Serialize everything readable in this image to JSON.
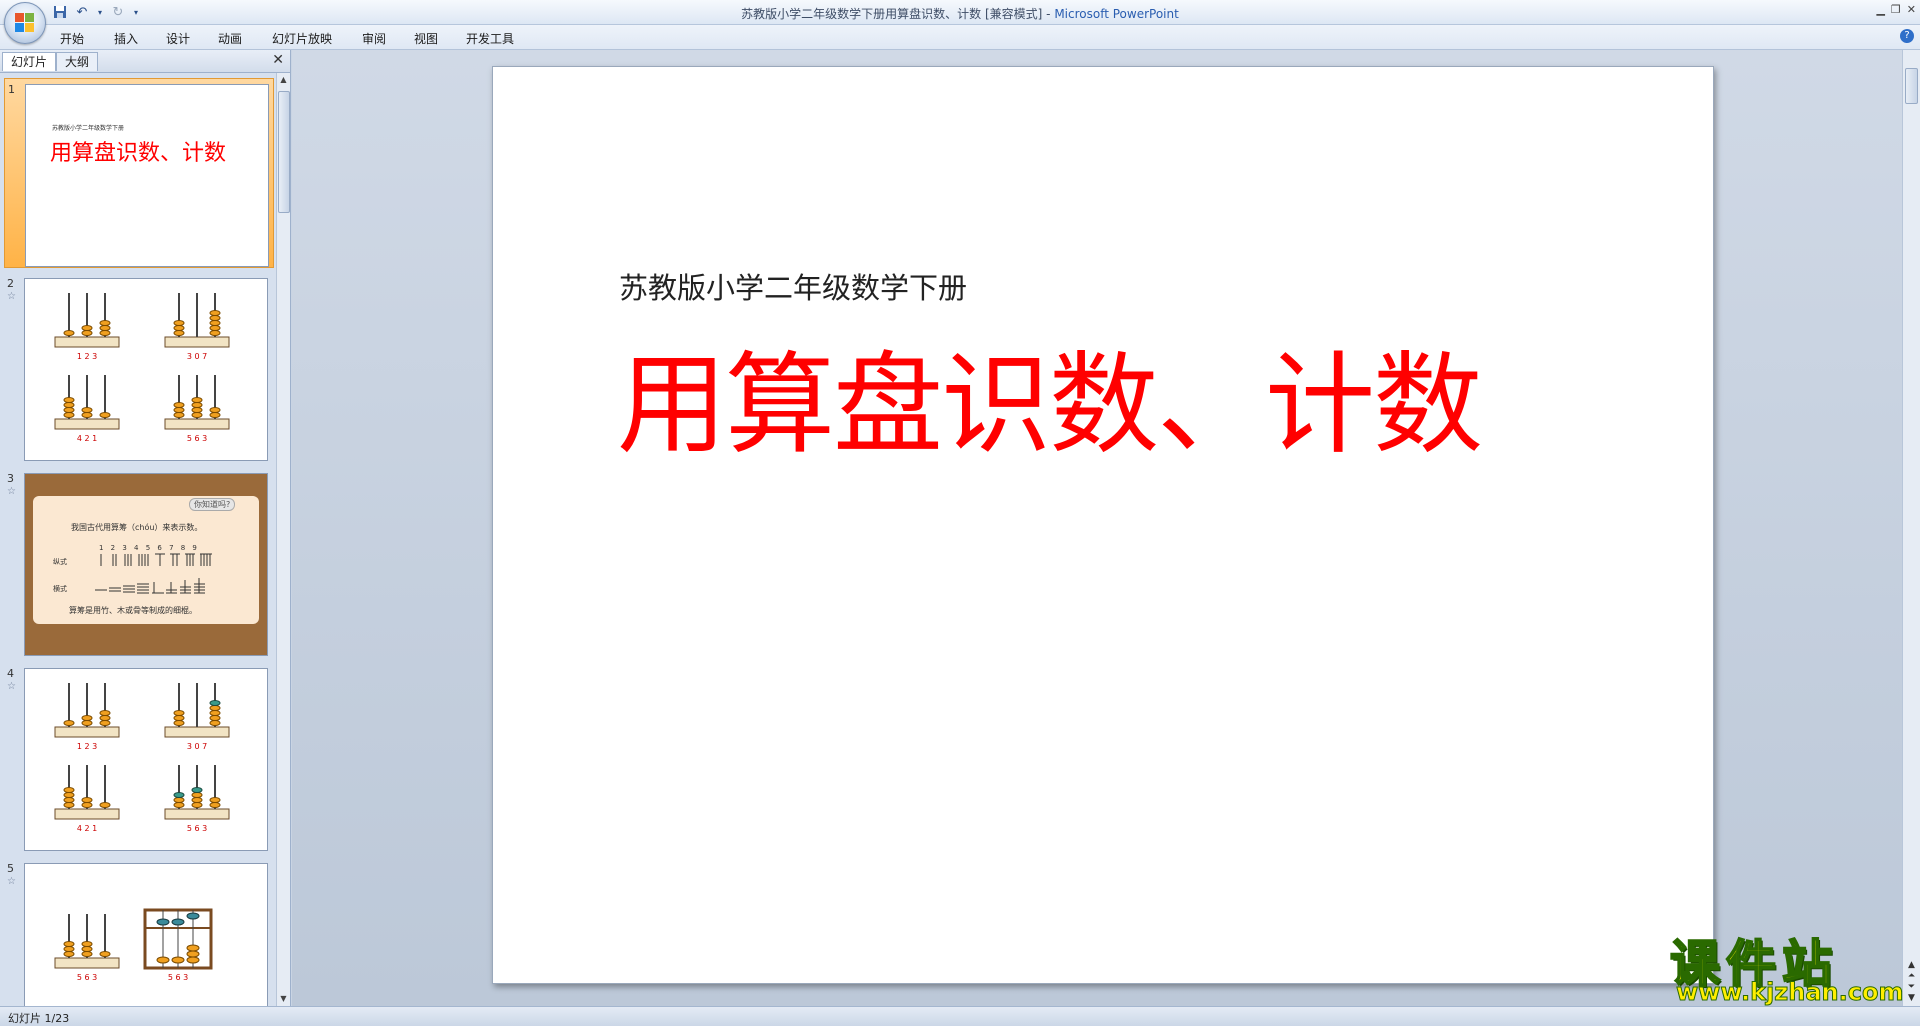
{
  "window": {
    "title_doc": "苏教版小学二年级数学下册用算盘识数、计数 [兼容模式]",
    "title_sep": " - ",
    "title_app": "Microsoft PowerPoint"
  },
  "ribbon": {
    "tabs": [
      "开始",
      "插入",
      "设计",
      "动画",
      "幻灯片放映",
      "审阅",
      "视图",
      "开发工具"
    ]
  },
  "panel": {
    "tabs": [
      "幻灯片",
      "大纲"
    ],
    "slides": [
      {
        "num": "1"
      },
      {
        "num": "2"
      },
      {
        "num": "3"
      },
      {
        "num": "4"
      },
      {
        "num": "5"
      }
    ]
  },
  "thumb1": {
    "small": "苏教版小学二年级数学下册",
    "title": "用算盘识数、计数"
  },
  "abacus": {
    "labels": [
      "1 2 3",
      "3 0 7",
      "4 2 1",
      "5 6 3"
    ]
  },
  "thumb3": {
    "badge": "你知道吗?",
    "line1": "我国古代用算筹（chóu）来表示数。",
    "digits": "1 2 3 4 5 6 7 8 9",
    "row1": "纵式",
    "row2": "横式",
    "footer": "算筹是用竹、木或骨等制成的细棍。"
  },
  "thumb5": {
    "labels": [
      "5 6 3",
      "5 6 3"
    ]
  },
  "slide": {
    "subtitle": "苏教版小学二年级数学下册",
    "title": "用算盘识数、计数"
  },
  "status": {
    "slide_info": "幻灯片 1/23"
  },
  "watermark": {
    "name": "课件站",
    "url": "www.kjzhan.com"
  },
  "colors": {
    "title_red": "#ff0000",
    "selection": "#ffb347",
    "watermark_yellow": "#ffee00"
  }
}
